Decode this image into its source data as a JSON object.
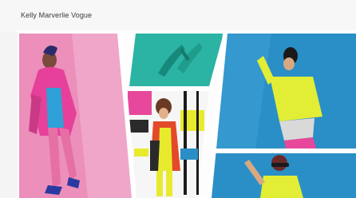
{
  "header": {
    "title": "Kelly Marverlie Vogue"
  },
  "gallery": {
    "panels": [
      {
        "subject": "model in pink jacket and blue bodysuit"
      },
      {
        "subject": "teal stiletto heels"
      },
      {
        "subject": "model in color-block dress with bob hairstyle"
      },
      {
        "subject": "model in yellow off-shoulder top on blue"
      },
      {
        "subject": "model in sunglasses and yellow top"
      }
    ],
    "colors": {
      "pink": "#e7489b",
      "teal": "#2bb3a3",
      "blue": "#2a8fc6",
      "yellow": "#e8ea2d",
      "frame": "#ffffff"
    }
  }
}
